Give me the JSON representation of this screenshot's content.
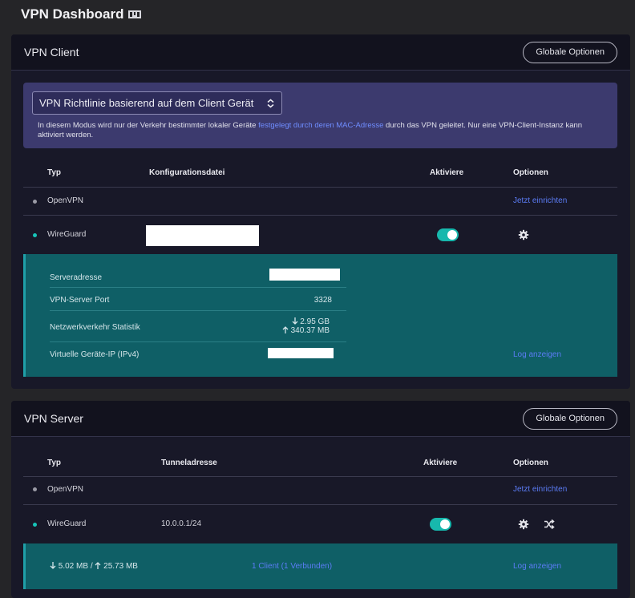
{
  "header": {
    "title": "VPN Dashboard",
    "icon": "vpn-map-icon"
  },
  "client": {
    "title": "VPN Client",
    "global_options": "Globale Optionen",
    "policy": {
      "selected": "VPN Richtlinie basierend auf dem Client Gerät",
      "desc_before": "In diesem Modus wird nur der Verkehr bestimmter lokaler Geräte ",
      "desc_link": "festgelegt durch deren MAC-Adresse",
      "desc_after": " durch das VPN geleitet. Nur eine VPN-Client-Instanz kann aktiviert werden."
    },
    "columns": [
      "Typ",
      "Konfigurationsdatei",
      "Aktiviere",
      "Optionen"
    ],
    "rows": [
      {
        "type": "OpenVPN",
        "action": "Jetzt einrichten",
        "status": "inactive"
      },
      {
        "type": "WireGuard",
        "active": true,
        "status": "connected"
      }
    ],
    "details": {
      "server_label": "Serveradresse",
      "port_label": "VPN-Server Port",
      "port_value": "3328",
      "traffic_label": "Netzwerkverkehr Statistik",
      "traffic_down": "2.95 GB",
      "traffic_up": "340.37 MB",
      "ip_label": "Virtuelle Geräte-IP (IPv4)",
      "log_link": "Log anzeigen"
    }
  },
  "server": {
    "title": "VPN Server",
    "global_options": "Globale Optionen",
    "columns": [
      "Typ",
      "Tunneladresse",
      "Aktiviere",
      "Optionen"
    ],
    "rows": [
      {
        "type": "OpenVPN",
        "action": "Jetzt einrichten",
        "status": "inactive"
      },
      {
        "type": "WireGuard",
        "tunnel": "10.0.0.1/24",
        "active": true,
        "status": "connected"
      }
    ],
    "details": {
      "down": "5.02 MB",
      "separator": "/",
      "up": "25.73 MB",
      "clients_link": "1 Client (1 Verbunden)",
      "log_link": "Log anzeigen"
    }
  },
  "colors": {
    "accent_teal": "#17b8ad",
    "link_blue": "#5b7cf5",
    "detail_bg": "#0f5f66",
    "policy_bg": "#3c3a6e"
  }
}
